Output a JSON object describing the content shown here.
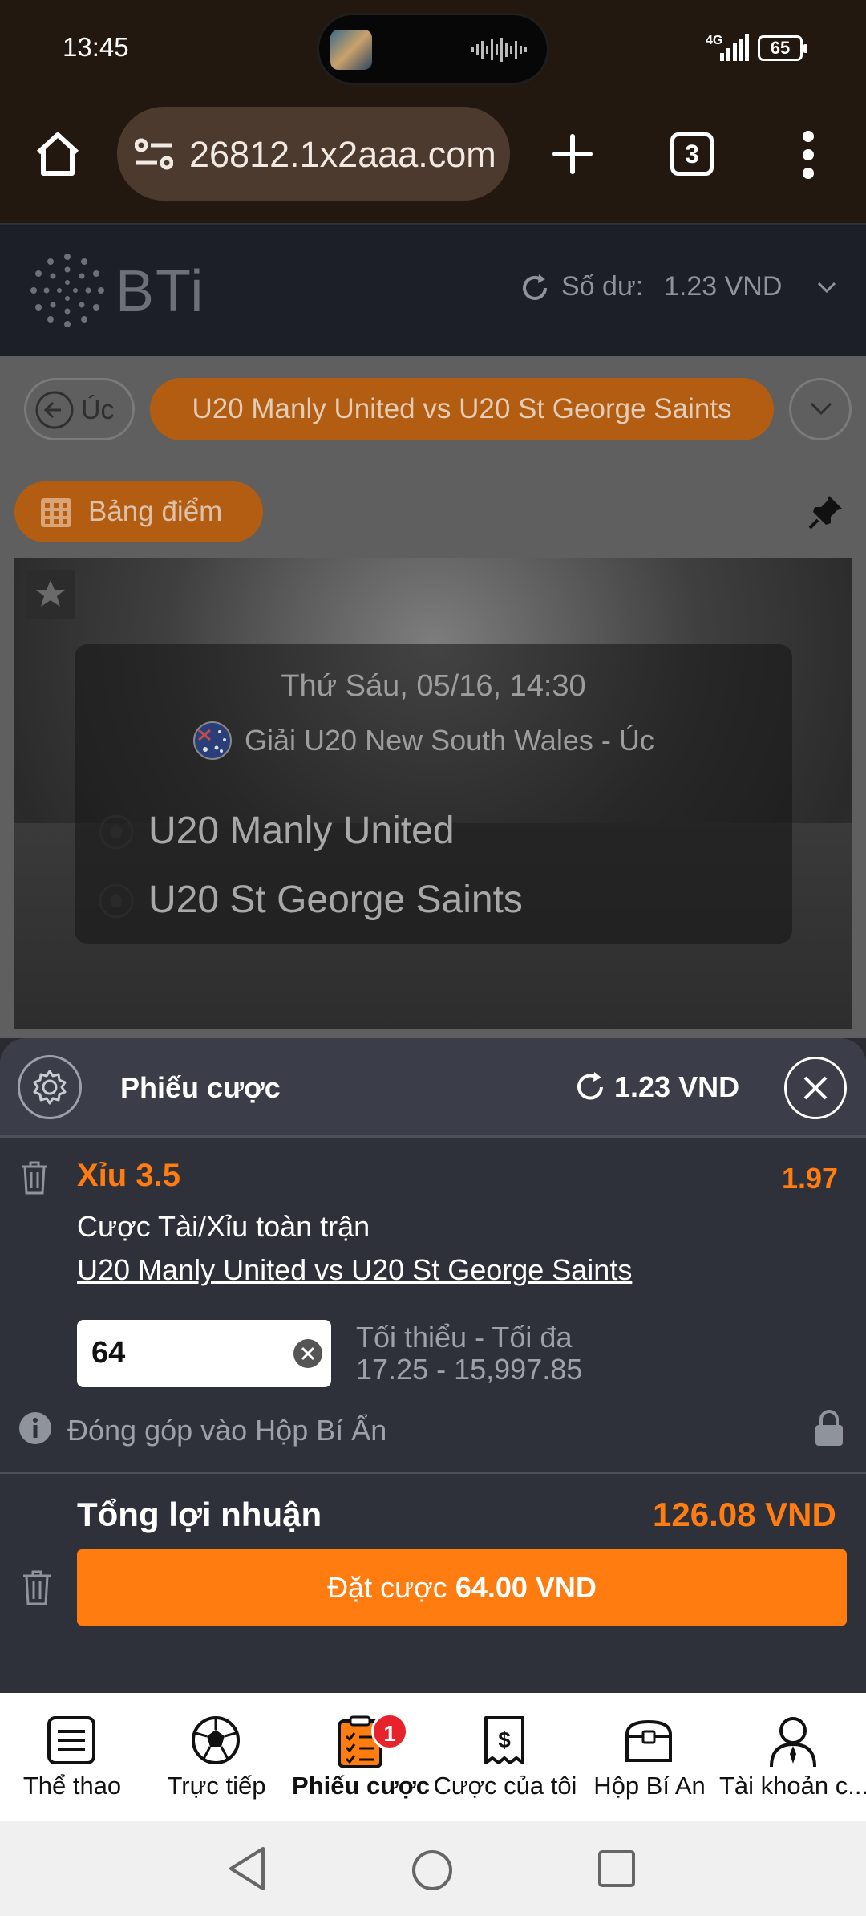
{
  "status_bar": {
    "time": "13:45",
    "network": "4G",
    "battery": "65"
  },
  "browser": {
    "url": "26812.1x2aaa.com",
    "tab_count": "3"
  },
  "site_header": {
    "logo": "BTi",
    "balance_label": "Số dư:",
    "balance_value": "1.23 VND"
  },
  "match_nav": {
    "prev_label": "Úc",
    "current_match": "U20 Manly United vs U20 St George Saints"
  },
  "scoreboard_button": "Bảng điểm",
  "event": {
    "datetime": "Thứ Sáu, 05/16, 14:30",
    "league": "Giải U20 New South Wales - Úc",
    "home_team": "U20 Manly United",
    "away_team": "U20 St George Saints"
  },
  "bet_slip": {
    "title": "Phiếu cược",
    "balance": "1.23 VND",
    "selection": "Xỉu 3.5",
    "odds": "1.97",
    "market": "Cược Tài/Xỉu toàn trận",
    "match": "U20 Manly United vs U20 St George Saints",
    "stake": "64",
    "minmax_label": "Tối thiểu - Tối đa",
    "minmax_value": "17.25 - 15,997.85",
    "contribution": "Đóng góp vào Hộp Bí Ẩn",
    "profit_label": "Tổng lợi nhuận",
    "profit_value": "126.08 VND",
    "place_label": "Đặt cược",
    "place_amount": "64.00 VND"
  },
  "bottom_nav": [
    {
      "label": "Thể thao",
      "icon": "list-icon"
    },
    {
      "label": "Trực tiếp",
      "icon": "football-icon"
    },
    {
      "label": "Phiếu cược",
      "icon": "betslip-icon",
      "badge": "1",
      "active": true
    },
    {
      "label": "Cược của tôi",
      "icon": "receipt-icon"
    },
    {
      "label": "Hộp Bí An",
      "icon": "chest-icon"
    },
    {
      "label": "Tài khoản c...",
      "icon": "account-icon"
    }
  ],
  "colors": {
    "accent": "#ff7d10",
    "slip_bg": "#2e313a",
    "header_bg": "#1c1f27",
    "browser_bg": "#23180f"
  }
}
